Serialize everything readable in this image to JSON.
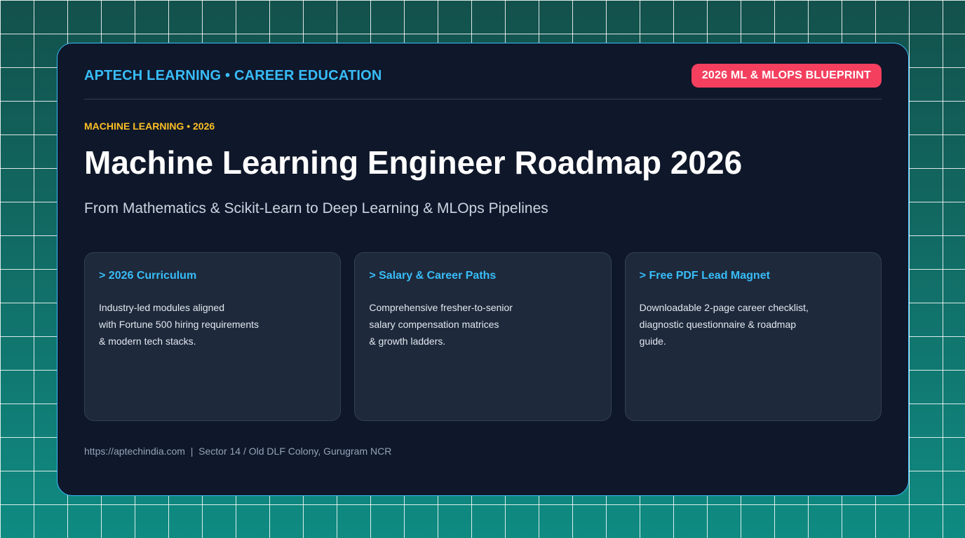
{
  "header": {
    "brand": "APTECH LEARNING • CAREER EDUCATION",
    "badge": "2026 ML & MLOPS BLUEPRINT"
  },
  "hero": {
    "kicker": "MACHINE LEARNING • 2026",
    "title": "Machine Learning Engineer Roadmap 2026",
    "subtitle": "From Mathematics & Scikit-Learn to Deep Learning & MLOps Pipelines"
  },
  "features": [
    {
      "title": "> 2026 Curriculum",
      "lines": [
        "Industry-led modules aligned",
        "with Fortune 500 hiring requirements",
        "& modern tech stacks."
      ]
    },
    {
      "title": "> Salary & Career Paths",
      "lines": [
        "Comprehensive fresher-to-senior",
        "salary compensation matrices",
        "& growth ladders."
      ]
    },
    {
      "title": "> Free PDF Lead Magnet",
      "lines": [
        "Downloadable 2-page career checklist,",
        "diagnostic questionnaire & roadmap",
        "guide."
      ]
    }
  ],
  "footer": {
    "text": "https://aptechindia.com  |  Sector 14 / Old DLF Colony, Gurugram NCR"
  },
  "colors": {
    "accent": "#38bdf8",
    "badge": "#f43f5e",
    "kicker": "#fbbf24",
    "card_bg": "#0f172a"
  }
}
